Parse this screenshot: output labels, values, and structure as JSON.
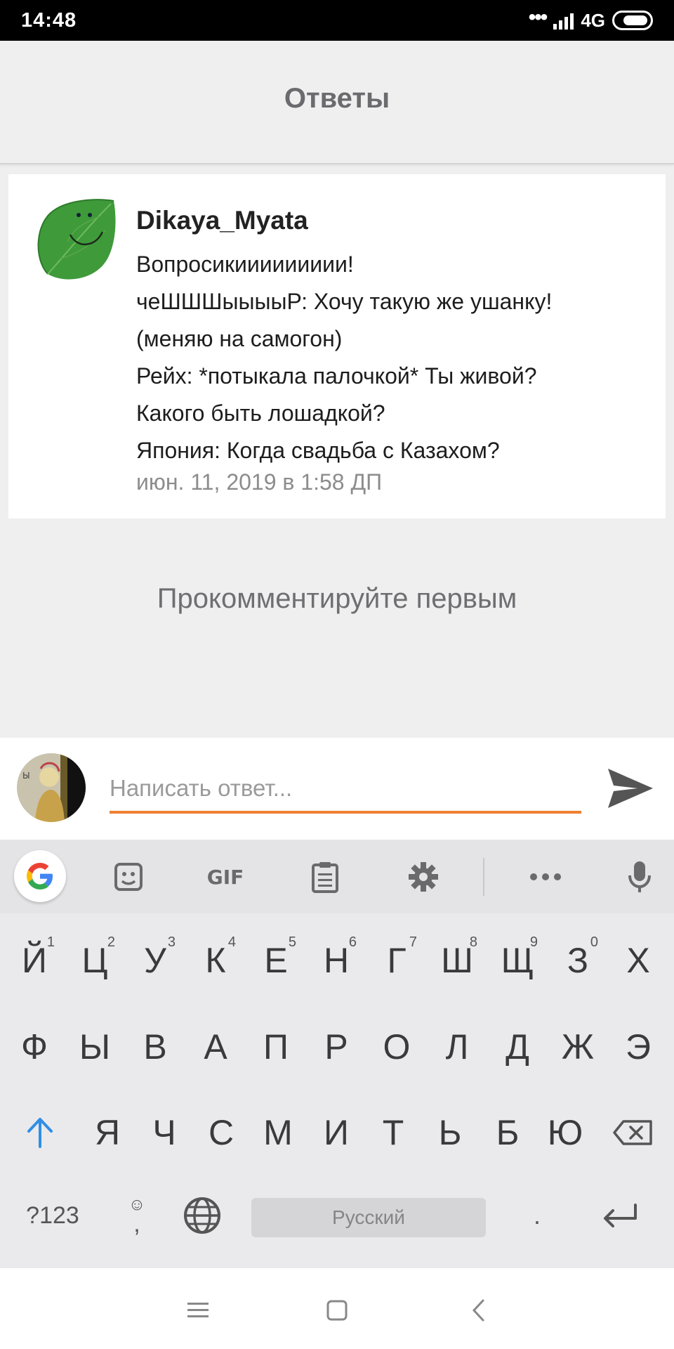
{
  "status_bar": {
    "time": "14:48",
    "network": "4G"
  },
  "header": {
    "title": "Ответы"
  },
  "post": {
    "author": "Dikaya_Myata",
    "lines": [
      "Вопросикиииииииии!",
      "чеШШШыыыыР: Хочу такую же ушанку!",
      "(меняю на самогон)",
      "Рейх: *потыкала палочкой* Ты живой?",
      "Какого быть лошадкой?",
      "Япония: Когда свадьба с Казахом?"
    ],
    "date": "июн. 11, 2019 в 1:58 ДП",
    "avatar_icon": "leaf-face-avatar"
  },
  "empty_message": "Прокомментируйте первым",
  "reply": {
    "placeholder": "Написать ответ...",
    "accent_color": "#ee8031",
    "send_icon": "send-icon"
  },
  "keyboard": {
    "toolbar": [
      "google-icon",
      "sticker-icon",
      "gif-icon",
      "clipboard-icon",
      "gear-icon",
      "more-icon",
      "mic-icon"
    ],
    "gif_label": "GIF",
    "row1": [
      "Й",
      "Ц",
      "У",
      "К",
      "Е",
      "Н",
      "Г",
      "Ш",
      "Щ",
      "З",
      "Х"
    ],
    "row1_hints": [
      "1",
      "2",
      "3",
      "4",
      "5",
      "6",
      "7",
      "8",
      "9",
      "0",
      ""
    ],
    "row2": [
      "Ф",
      "Ы",
      "В",
      "А",
      "П",
      "Р",
      "О",
      "Л",
      "Д",
      "Ж",
      "Э"
    ],
    "row3": [
      "Я",
      "Ч",
      "С",
      "М",
      "И",
      "Т",
      "Ь",
      "Б",
      "Ю"
    ],
    "symbols_label": "?123",
    "comma": ",",
    "period": ".",
    "space_label": "Русский",
    "shift_color": "#2f8ee6"
  },
  "navbar": [
    "menu-icon",
    "home-icon",
    "back-icon"
  ]
}
